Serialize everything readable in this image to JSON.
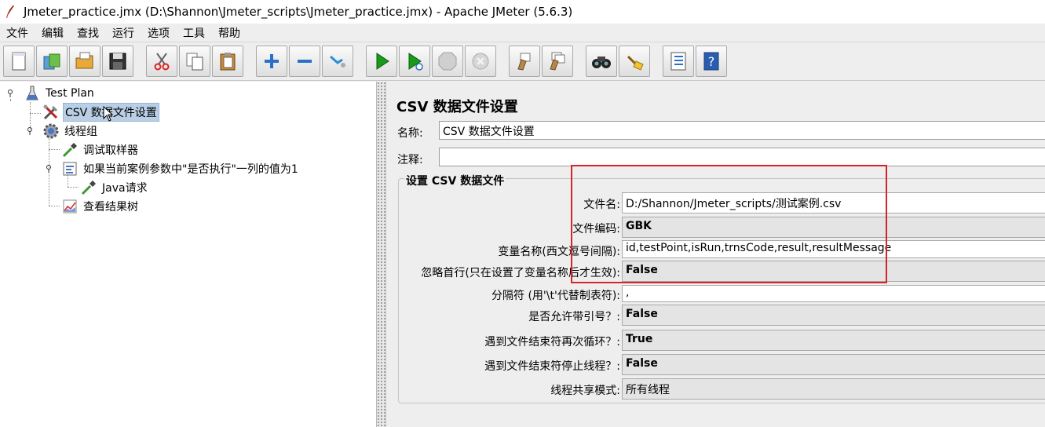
{
  "window": {
    "title": "Jmeter_practice.jmx (D:\\Shannon\\Jmeter_scripts\\Jmeter_practice.jmx) - Apache JMeter (5.6.3)"
  },
  "menu": [
    "文件",
    "编辑",
    "查找",
    "运行",
    "选项",
    "工具",
    "帮助"
  ],
  "toolbar": [
    {
      "name": "new-icon"
    },
    {
      "name": "templates-icon"
    },
    {
      "name": "open-icon"
    },
    {
      "name": "save-icon"
    },
    {
      "name": "cut-icon"
    },
    {
      "name": "copy-icon"
    },
    {
      "name": "paste-icon"
    },
    {
      "name": "expand-icon"
    },
    {
      "name": "collapse-icon"
    },
    {
      "name": "toggle-icon"
    },
    {
      "name": "start-icon"
    },
    {
      "name": "start-no-pauses-icon"
    },
    {
      "name": "stop-icon"
    },
    {
      "name": "shutdown-icon"
    },
    {
      "name": "clear-icon"
    },
    {
      "name": "clear-all-icon"
    },
    {
      "name": "search-icon"
    },
    {
      "name": "reset-search-icon"
    },
    {
      "name": "function-helper-icon"
    },
    {
      "name": "help-icon"
    }
  ],
  "tree": {
    "nodes": [
      {
        "label": "Test Plan",
        "icon": "flask-icon"
      },
      {
        "label": "CSV 数据文件设置",
        "icon": "tools-icon",
        "selected": true
      },
      {
        "label": "线程组",
        "icon": "gear-icon"
      },
      {
        "label": "调试取样器",
        "icon": "pipette-icon"
      },
      {
        "label": "如果当前案例参数中\"是否执行\"一列的值为1",
        "icon": "if-controller-icon"
      },
      {
        "label": "Java请求",
        "icon": "pipette-icon"
      },
      {
        "label": "查看结果树",
        "icon": "chart-icon"
      }
    ]
  },
  "panel": {
    "title": "CSV 数据文件设置",
    "name_label": "名称:",
    "name_value": "CSV 数据文件设置",
    "comment_label": "注释:",
    "comment_value": "",
    "group_title": "设置 CSV 数据文件",
    "rows": [
      {
        "label": "文件名:",
        "value": "D:/Shannon/Jmeter_scripts/测试案例.csv",
        "kind": "plain"
      },
      {
        "label": "文件编码:",
        "value": "GBK",
        "kind": "combo"
      },
      {
        "label": "变量名称(西文逗号间隔):",
        "value": "id,testPoint,isRun,trnsCode,result,resultMessage",
        "kind": "plain"
      },
      {
        "label": "忽略首行(只在设置了变量名称后才生效):",
        "value": "False",
        "kind": "combo"
      },
      {
        "label": "分隔符 (用'\\t'代替制表符):",
        "value": ",",
        "kind": "plain"
      },
      {
        "label": "是否允许带引号？:",
        "value": "False",
        "kind": "combo"
      },
      {
        "label": "遇到文件结束符再次循环？:",
        "value": "True",
        "kind": "combo"
      },
      {
        "label": "遇到文件结束符停止线程？:",
        "value": "False",
        "kind": "combo"
      },
      {
        "label": "线程共享模式:",
        "value": "所有线程",
        "kind": "combo-plain"
      }
    ]
  },
  "colors": {
    "selection": "#b8cfe5",
    "annotation": "#d9232a",
    "start_green": "#1a9a1a"
  }
}
